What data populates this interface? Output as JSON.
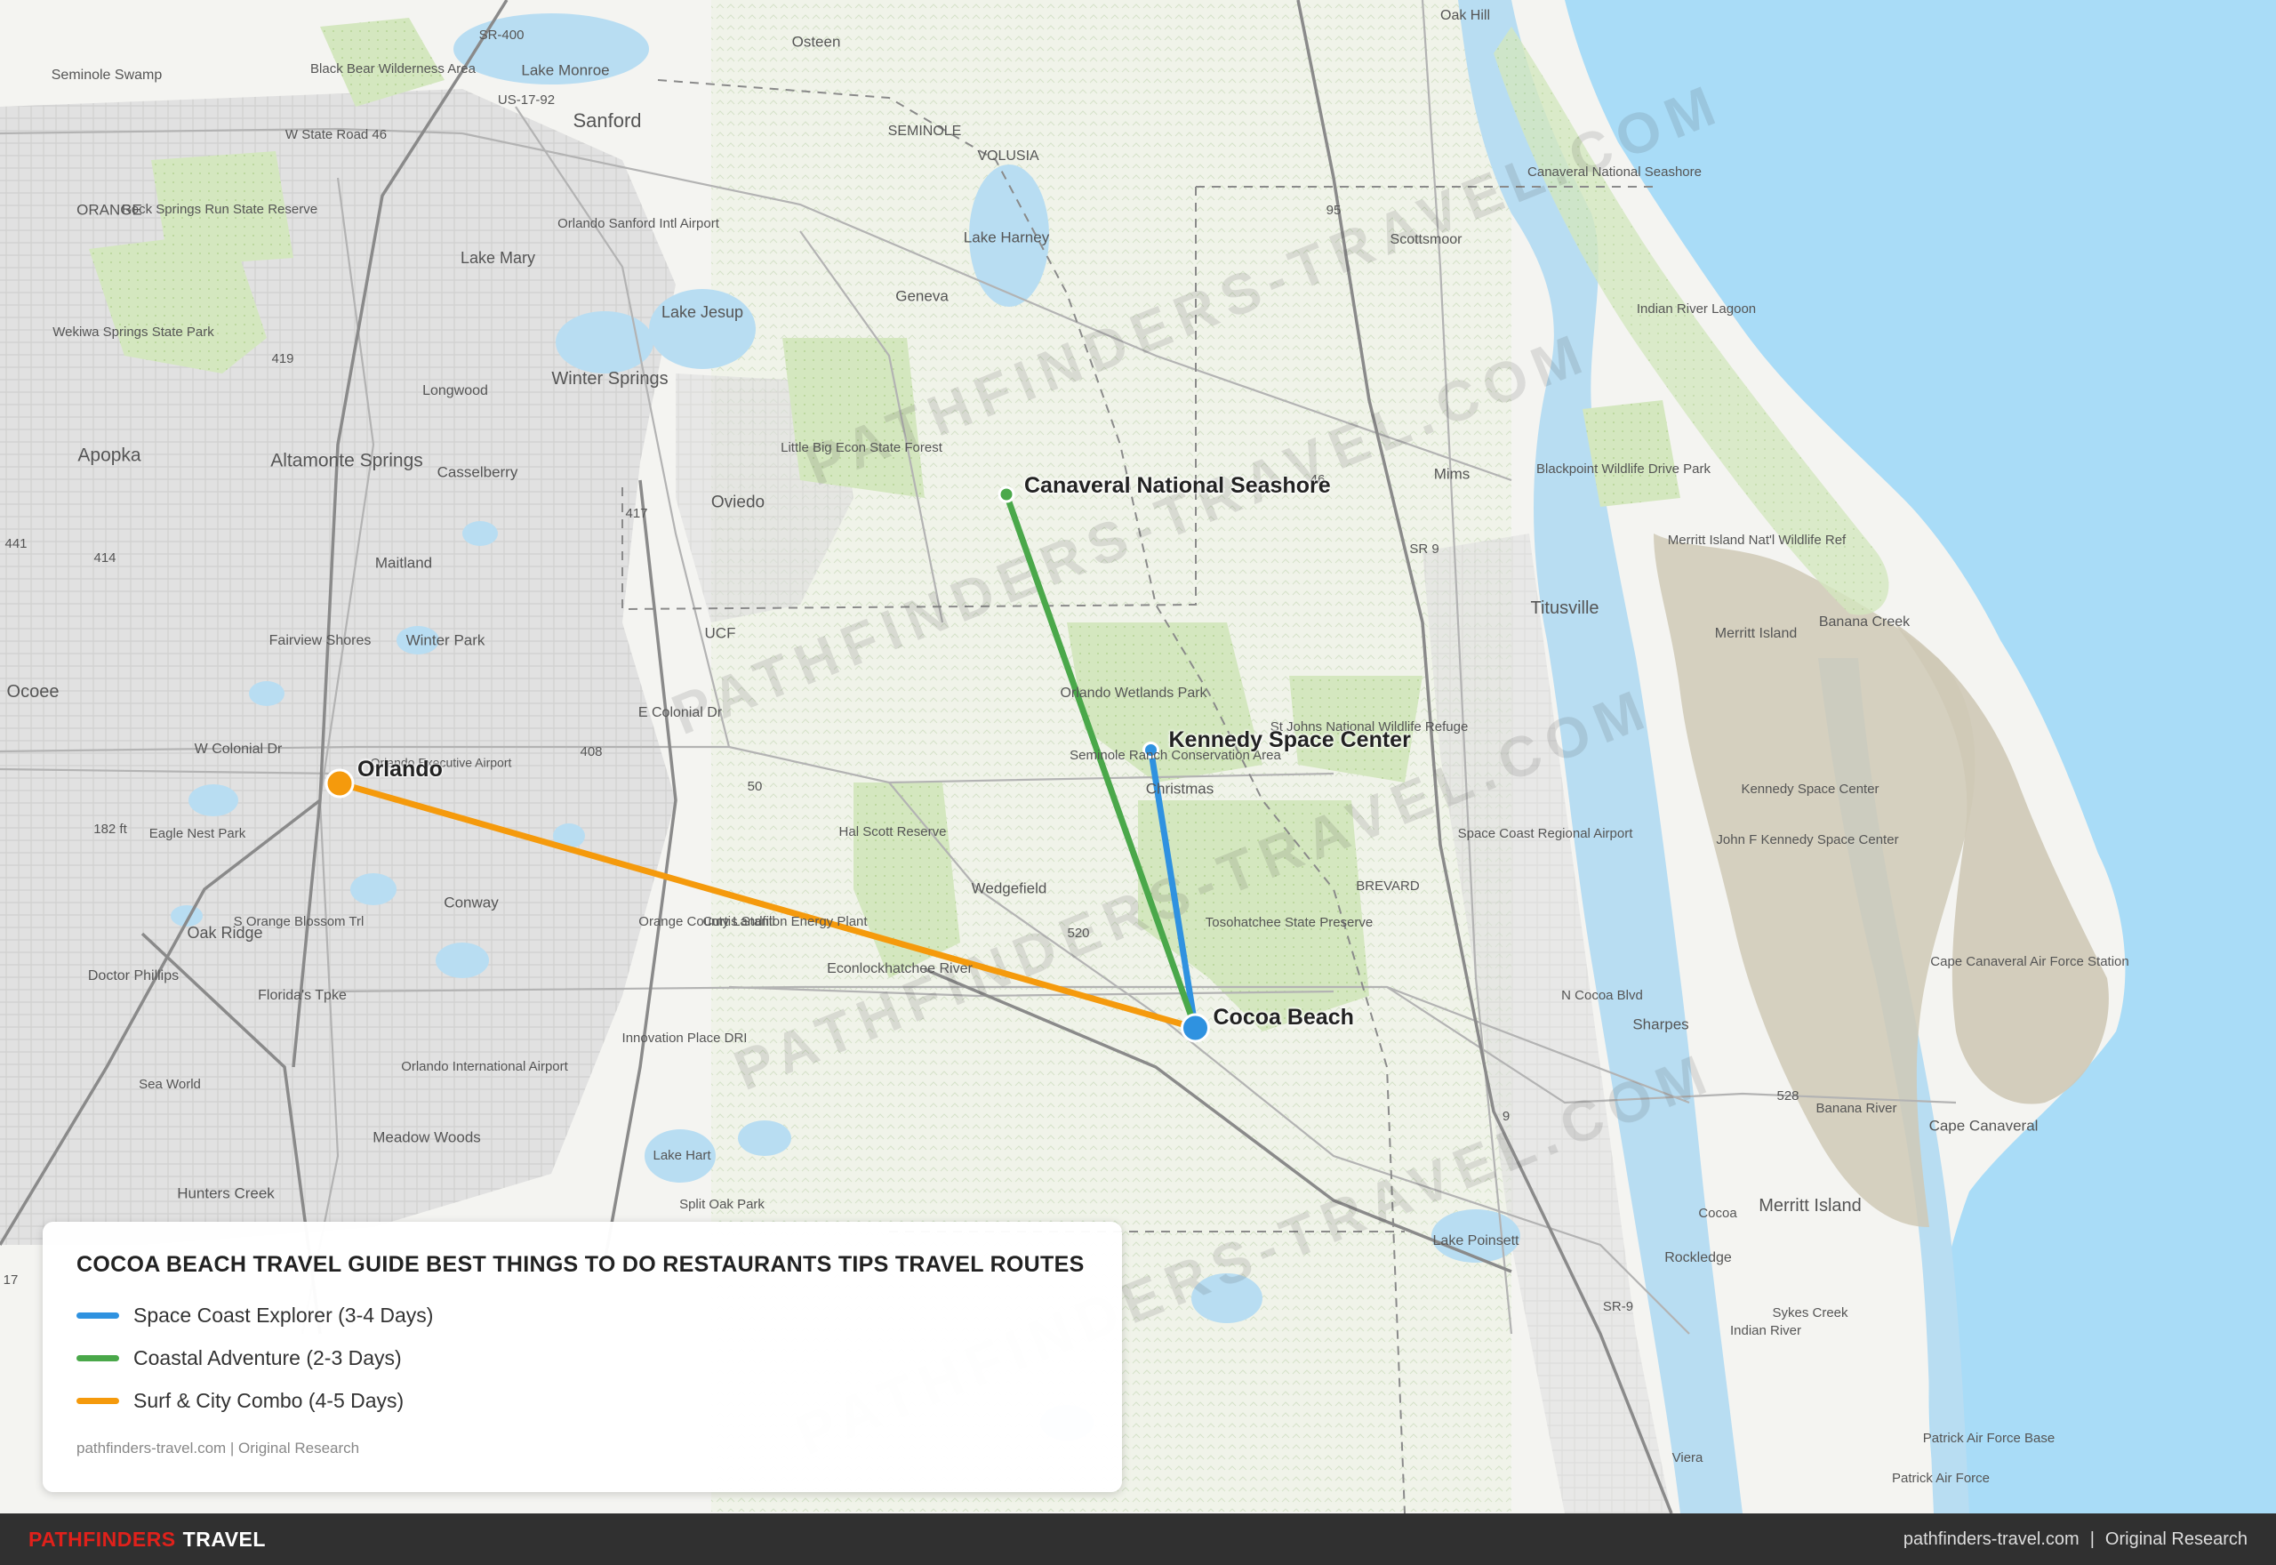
{
  "map": {
    "colors": {
      "ocean": "#a9dcf7",
      "land": "#f4f4f1",
      "urban": "#dcdcd8",
      "park": "#cfe5b6",
      "cape": "#cfc9b6",
      "water": "#b8ddf2",
      "road": "#b3b3b3",
      "highway": "#888888"
    },
    "watermark": "PATHFINDERS-TRAVEL.COM",
    "basemap_labels": [
      "Oak Hill",
      "Osteen",
      "Seminole Swamp",
      "Black Bear Wilderness Area",
      "Lake Monroe",
      "Sanford",
      "W State Road 46",
      "Rock Springs Run State Reserve",
      "ORANGE",
      "Orlando Sanford Intl Airport",
      "SEMINOLE",
      "VOLUSIA",
      "Lake Harney",
      "Canaveral National Seashore",
      "Scottsmoor",
      "Lake Mary",
      "Lake Jesup",
      "Geneva",
      "Wekiwa Springs State Park",
      "Longwood",
      "Winter Springs",
      "Apopka",
      "Altamonte Springs",
      "Casselberry",
      "Little Big Econ State Forest",
      "Oviedo",
      "Mims",
      "Blackpoint Wildlife Drive Park",
      "Merritt Island Nat'l Wildlife Ref",
      "Maitland",
      "Titusville",
      "Fairview Shores",
      "Winter Park",
      "UCF",
      "Banana Creek",
      "Merritt Island",
      "Ocoee",
      "E Colonial Dr",
      "Orlando Wetlands Park",
      "St Johns National Wildlife Refuge",
      "W Colonial Dr",
      "Orlando Executive Airport",
      "Seminole Ranch Conservation Area",
      "Christmas",
      "Kennedy Space Center",
      "John F Kennedy Space Center",
      "Hal Scott Reserve",
      "Eagle Nest Park",
      "182 ft",
      "Space Coast Regional Airport",
      "Conway",
      "Orange County Landfill",
      "Curtis Stanton Energy Plant",
      "Wedgefield",
      "Econlockhatchee River",
      "BREVARD",
      "Tosohatchee State Preserve",
      "Cape Canaveral Air Force Station",
      "Oak Ridge",
      "Doctor Phillips",
      "Florida's Tpke",
      "S Orange Blossom Trl",
      "Orlando International Airport",
      "Innovation Place DRI",
      "Sharpes",
      "Sea World",
      "Meadow Woods",
      "Lake Hart",
      "Cape Canaveral",
      "Hunters Creek",
      "Split Oak Park",
      "Lake Poinsett",
      "Cocoa",
      "Merritt Island",
      "Rockledge",
      "Banana River",
      "Indian River",
      "Sykes Creek",
      "Patrick Air Force Base",
      "Patrick Air Force",
      "Viera",
      "N Cocoa Blvd",
      "Indian River Lagoon",
      "SR-400",
      "US-17-92",
      "SR-9",
      "SR 9",
      "417",
      "408",
      "414",
      "419",
      "50",
      "46",
      "528",
      "520",
      "95",
      "9",
      "441",
      "17"
    ],
    "places": [
      {
        "name": "Canaveral National Seashore",
        "lon": -80.78,
        "lat": 28.8
      },
      {
        "name": "Kennedy Space Center",
        "lon": -80.65,
        "lat": 28.57
      },
      {
        "name": "Orlando",
        "lon": -81.38,
        "lat": 28.54
      },
      {
        "name": "Cocoa Beach",
        "lon": -80.61,
        "lat": 28.32
      }
    ],
    "routes": [
      {
        "name": "Space Coast Explorer (3-4 Days)",
        "color": "#2f92e0",
        "stops": [
          "Kennedy Space Center",
          "Cocoa Beach"
        ]
      },
      {
        "name": "Coastal Adventure (2-3 Days)",
        "color": "#4aa84a",
        "stops": [
          "Canaveral National Seashore",
          "Cocoa Beach"
        ]
      },
      {
        "name": "Surf & City Combo (4-5 Days)",
        "color": "#f59a0c",
        "stops": [
          "Orlando",
          "Cocoa Beach"
        ]
      }
    ]
  },
  "legend": {
    "title": "COCOA BEACH TRAVEL GUIDE BEST THINGS TO DO RESTAURANTS TIPS TRAVEL ROUTES",
    "items": [
      {
        "label": "Space Coast Explorer (3-4 Days)",
        "color": "#2f92e0"
      },
      {
        "label": "Coastal Adventure (2-3 Days)",
        "color": "#4aa84a"
      },
      {
        "label": "Surf & City Combo (4-5 Days)",
        "color": "#f59a0c"
      }
    ],
    "source": "pathfinders-travel.com | Original Research"
  },
  "footer": {
    "brand_part1": "PATHFINDERS",
    "brand_part2": "TRAVEL",
    "site": "pathfinders-travel.com",
    "note": "Original Research"
  }
}
